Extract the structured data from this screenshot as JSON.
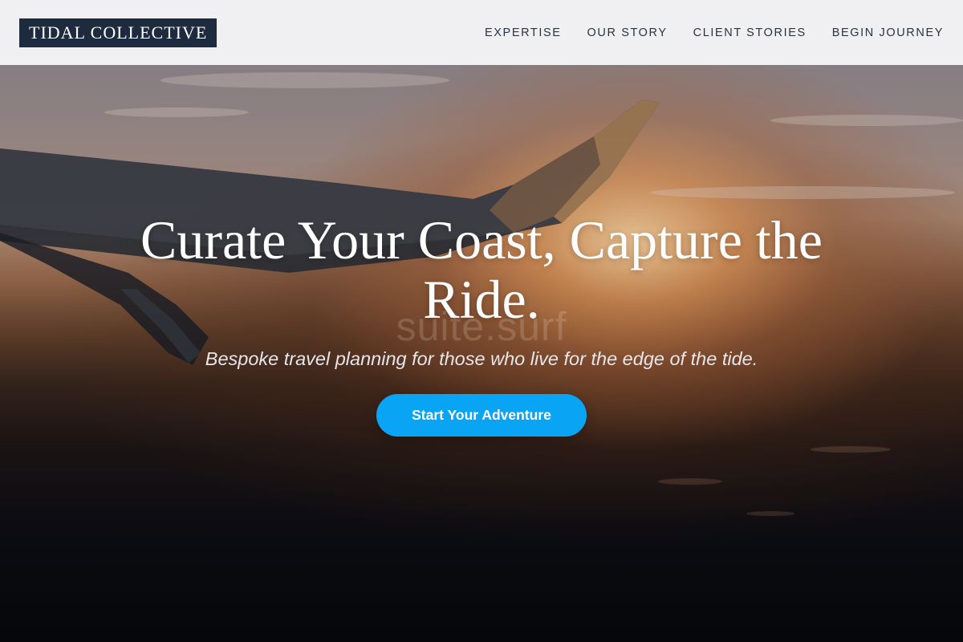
{
  "brand": {
    "logo_text": "TIDAL COLLECTIVE"
  },
  "nav": {
    "items": [
      {
        "label": "EXPERTISE"
      },
      {
        "label": "OUR STORY"
      },
      {
        "label": "CLIENT STORIES"
      },
      {
        "label": "BEGIN JOURNEY"
      }
    ]
  },
  "hero": {
    "headline": "Curate Your Coast, Capture the Ride.",
    "watermark": "suite.surf",
    "tagline": "Bespoke travel planning for those who live for the edge of the tide.",
    "cta_label": "Start Your Adventure",
    "background_image": "airplane-wing-sunset"
  },
  "colors": {
    "header_bg": "#f5f5f7",
    "logo_bg": "#1e2a3e",
    "nav_text": "#2a3344",
    "cta_bg": "#0aa4f5",
    "headline_text": "#ffffff"
  }
}
